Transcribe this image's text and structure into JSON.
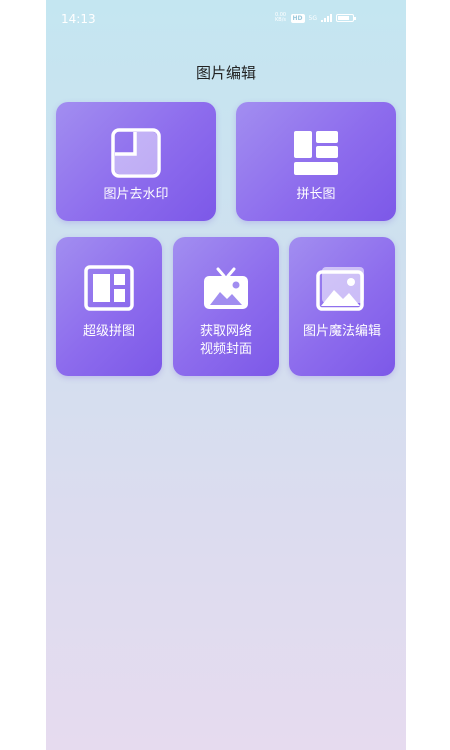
{
  "status_bar": {
    "time": "14:13",
    "net_speed_top": "0.00",
    "net_speed_unit": "KB/s",
    "hd_badge": "HD",
    "network": "5G",
    "battery_level": 0.75
  },
  "page": {
    "title": "图片编辑"
  },
  "tools": [
    {
      "label": "图片去水印",
      "icon": "watermark-remove-icon"
    },
    {
      "label": "拼长图",
      "icon": "long-collage-icon"
    },
    {
      "label": "超级拼图",
      "icon": "super-collage-icon"
    },
    {
      "label_line1": "获取网络",
      "label_line2": "视频封面",
      "icon": "video-cover-icon"
    },
    {
      "label": "图片魔法编辑",
      "icon": "image-magic-icon"
    }
  ],
  "colors": {
    "card_start": "#a28ef0",
    "card_end": "#7c58e8",
    "bg_top": "#c4e6f1",
    "bg_bottom": "#e6dbef"
  }
}
